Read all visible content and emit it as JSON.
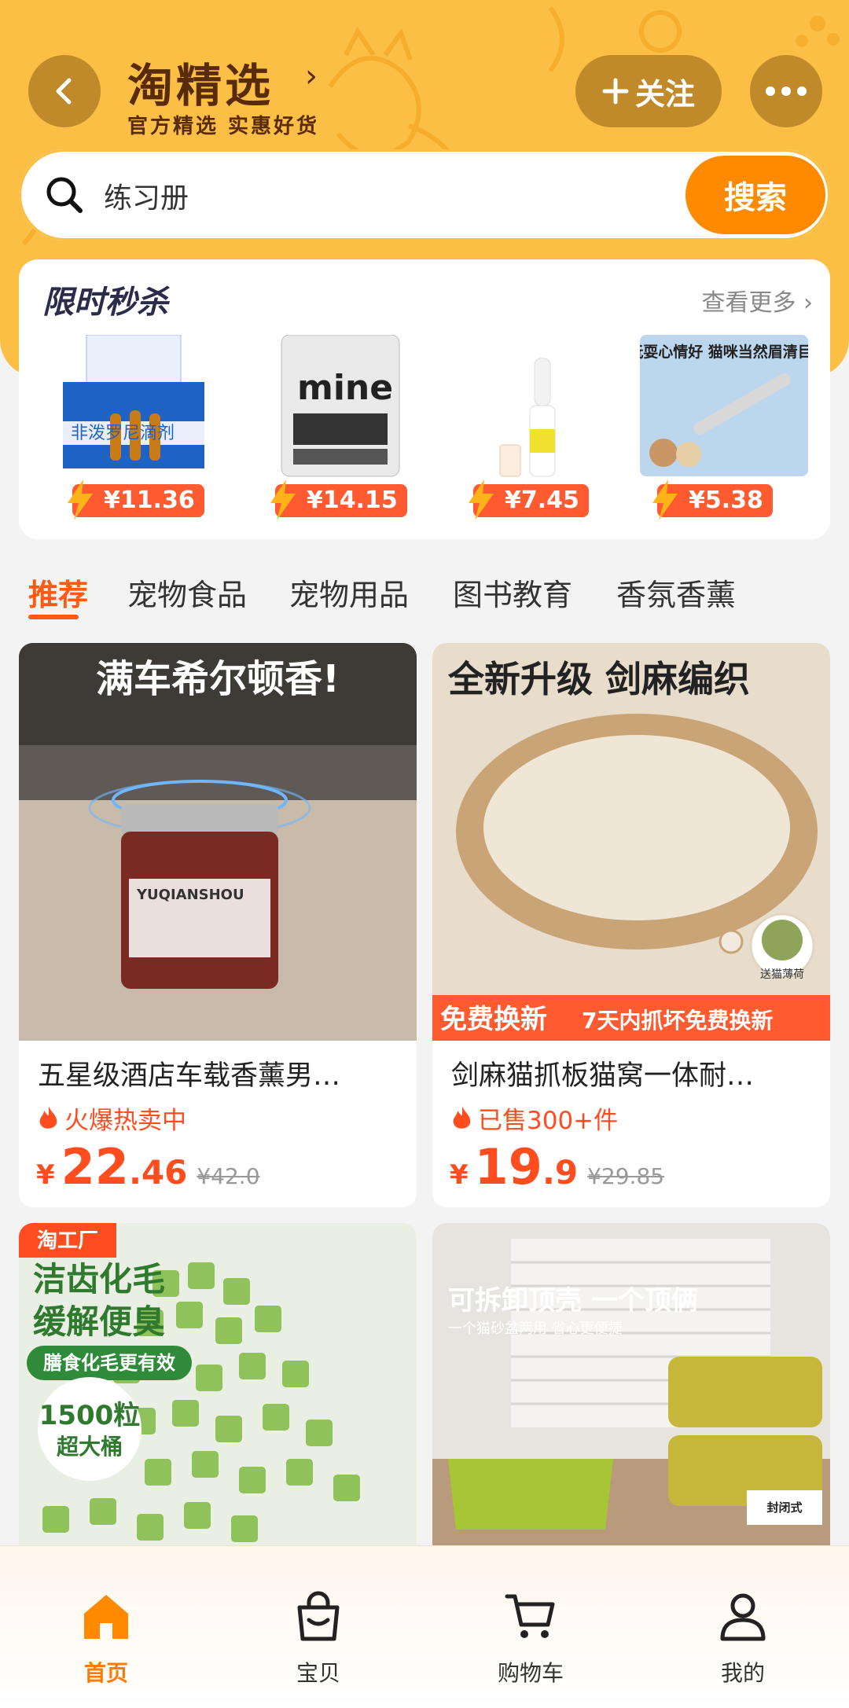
{
  "header": {
    "title": "淘精选",
    "title_arrow": "›",
    "subtitle": "官方精选 实惠好货",
    "follow_label": "关注",
    "follow_icon": "plus-icon",
    "back_icon": "back-arrow-icon",
    "more_icon": "more-dots-icon"
  },
  "search": {
    "value": "练习册",
    "button_label": "搜索"
  },
  "flash_sale": {
    "title": "限时秒杀",
    "more_label": "查看更多 ›",
    "items": [
      {
        "price": "¥11.36",
        "image_text": "非泼罗尼滴剂"
      },
      {
        "price": "¥14.15",
        "image_text": "mine"
      },
      {
        "price": "¥7.45",
        "image_text": ""
      },
      {
        "price": "¥5.38",
        "image_text": "玩耍心情好 猫咪当然眉清目秀"
      }
    ]
  },
  "tabs": [
    "推荐",
    "宠物食品",
    "宠物用品",
    "图书教育",
    "香氛香薰"
  ],
  "products": [
    {
      "title": "五星级酒店车载香薰男…",
      "sales": "火爆热卖中",
      "currency": "¥",
      "price_int": "22",
      "price_dec": ".46",
      "original_price": "¥42.0",
      "image_caption": "满车希尔顿香!",
      "image_brand": "YUQIANSHOU"
    },
    {
      "title": "剑麻猫抓板猫窝一体耐…",
      "sales": "已售300+件",
      "currency": "¥",
      "price_int": "19",
      "price_dec": ".9",
      "original_price": "¥29.85",
      "image_caption": "全新升级 剑麻编织",
      "image_badge_left": "免费换新",
      "image_badge_right": "7天内抓坏免费换新",
      "image_corner": "送猫薄荷"
    },
    {
      "image_badge": "淘工厂",
      "image_caption_1": "洁齿化毛",
      "image_caption_2": "缓解便臭",
      "image_tag": "膳食化毛更有效",
      "image_circle_1": "1500粒",
      "image_circle_2": "超大桶"
    },
    {
      "image_caption": "可拆卸顶壳 一个顶俩",
      "image_sub": "一个猫砂盆两用 省心更便捷",
      "image_corner": "封闭式"
    }
  ],
  "bottom_nav": [
    {
      "label": "首页",
      "icon": "home-icon",
      "active": true
    },
    {
      "label": "宝贝",
      "icon": "bag-icon",
      "active": false
    },
    {
      "label": "购物车",
      "icon": "cart-icon",
      "active": false
    },
    {
      "label": "我的",
      "icon": "user-icon",
      "active": false
    }
  ],
  "colors": {
    "header_bg": "#fbbf46",
    "accent": "#ff8a00",
    "price": "#ff4d20",
    "active_tab": "#ff5a14"
  }
}
